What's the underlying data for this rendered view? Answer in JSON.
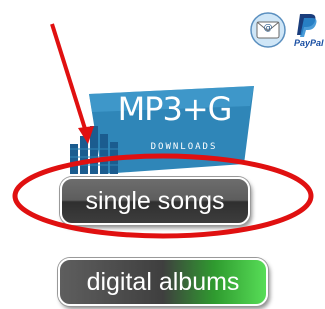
{
  "paypal": {
    "sub_label": "PayPal"
  },
  "logo": {
    "title": "MP3+G",
    "subtitle": "DOWNLOADS"
  },
  "buttons": {
    "single_songs": "single songs",
    "digital_albums": "digital albums"
  },
  "icons": {
    "email": "email-envelope-icon",
    "paypal": "paypal-icon",
    "logo": "music-equalizer-logo-icon",
    "arrow": "red-arrow-annotation",
    "highlight": "red-ellipse-annotation"
  },
  "colors": {
    "accent_blue": "#2f86b8",
    "annotation_red": "#e01010",
    "album_button_green": "#57dd57",
    "button_dark": "#3d3d3d"
  }
}
